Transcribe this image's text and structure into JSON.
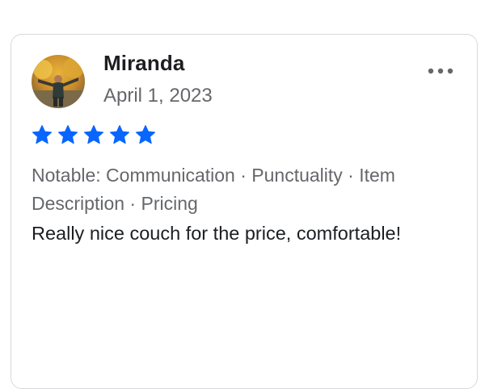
{
  "review": {
    "reviewer_name": "Miranda",
    "date": "April 1, 2023",
    "rating": 5,
    "max_rating": 5,
    "notable_label": "Notable: Communication · Punctuality · Item Description · Pricing",
    "text": "Really nice couch for the price, comfortable!"
  },
  "icons": {
    "avatar": "reviewer-photo",
    "more": "more-options-icon",
    "star": "star-icon"
  },
  "colors": {
    "star": "#0866ff",
    "name": "#1c1e21",
    "secondary": "#65676b",
    "border": "#d6d9de"
  }
}
